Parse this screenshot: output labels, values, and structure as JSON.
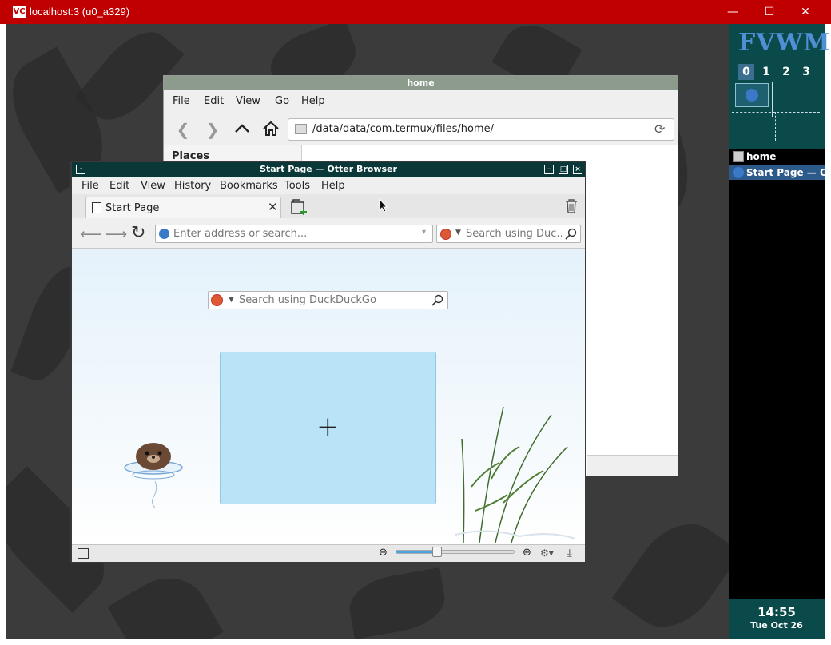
{
  "vnc": {
    "title": "localhost:3 (u0_a329)",
    "logo": "VC",
    "minimize": "—",
    "maximize": "☐",
    "close": "✕"
  },
  "panel": {
    "logo": "FVWM",
    "desks": [
      "0",
      "1",
      "2",
      "3"
    ],
    "active_desk": "0",
    "tasks": [
      {
        "label": "home",
        "icon": "folder-icon",
        "active": false
      },
      {
        "label": "Start Page — Otter Browser",
        "icon": "otter-icon",
        "active": true
      }
    ],
    "clock": {
      "time": "14:55",
      "date": "Tue Oct 26"
    }
  },
  "file_manager": {
    "title": "home",
    "menu": [
      "File",
      "Edit",
      "View",
      "Go",
      "Help"
    ],
    "path": "/data/data/com.termux/files/home/",
    "sidebar_heading": "Places"
  },
  "browser": {
    "title": "Start Page — Otter Browser",
    "menu": [
      "File",
      "Edit",
      "View",
      "History",
      "Bookmarks",
      "Tools",
      "Help"
    ],
    "tab": {
      "label": "Start Page",
      "close": "✕"
    },
    "address_placeholder": "Enter address or search...",
    "search_placeholder": "Search using Duc...",
    "start_search_placeholder": "Search using DuckDuckGo",
    "zoom_percent": 35,
    "colors": {
      "titlebar": "#0a3838",
      "tile": "#b9e3f6",
      "accent": "#4aa3df"
    }
  }
}
